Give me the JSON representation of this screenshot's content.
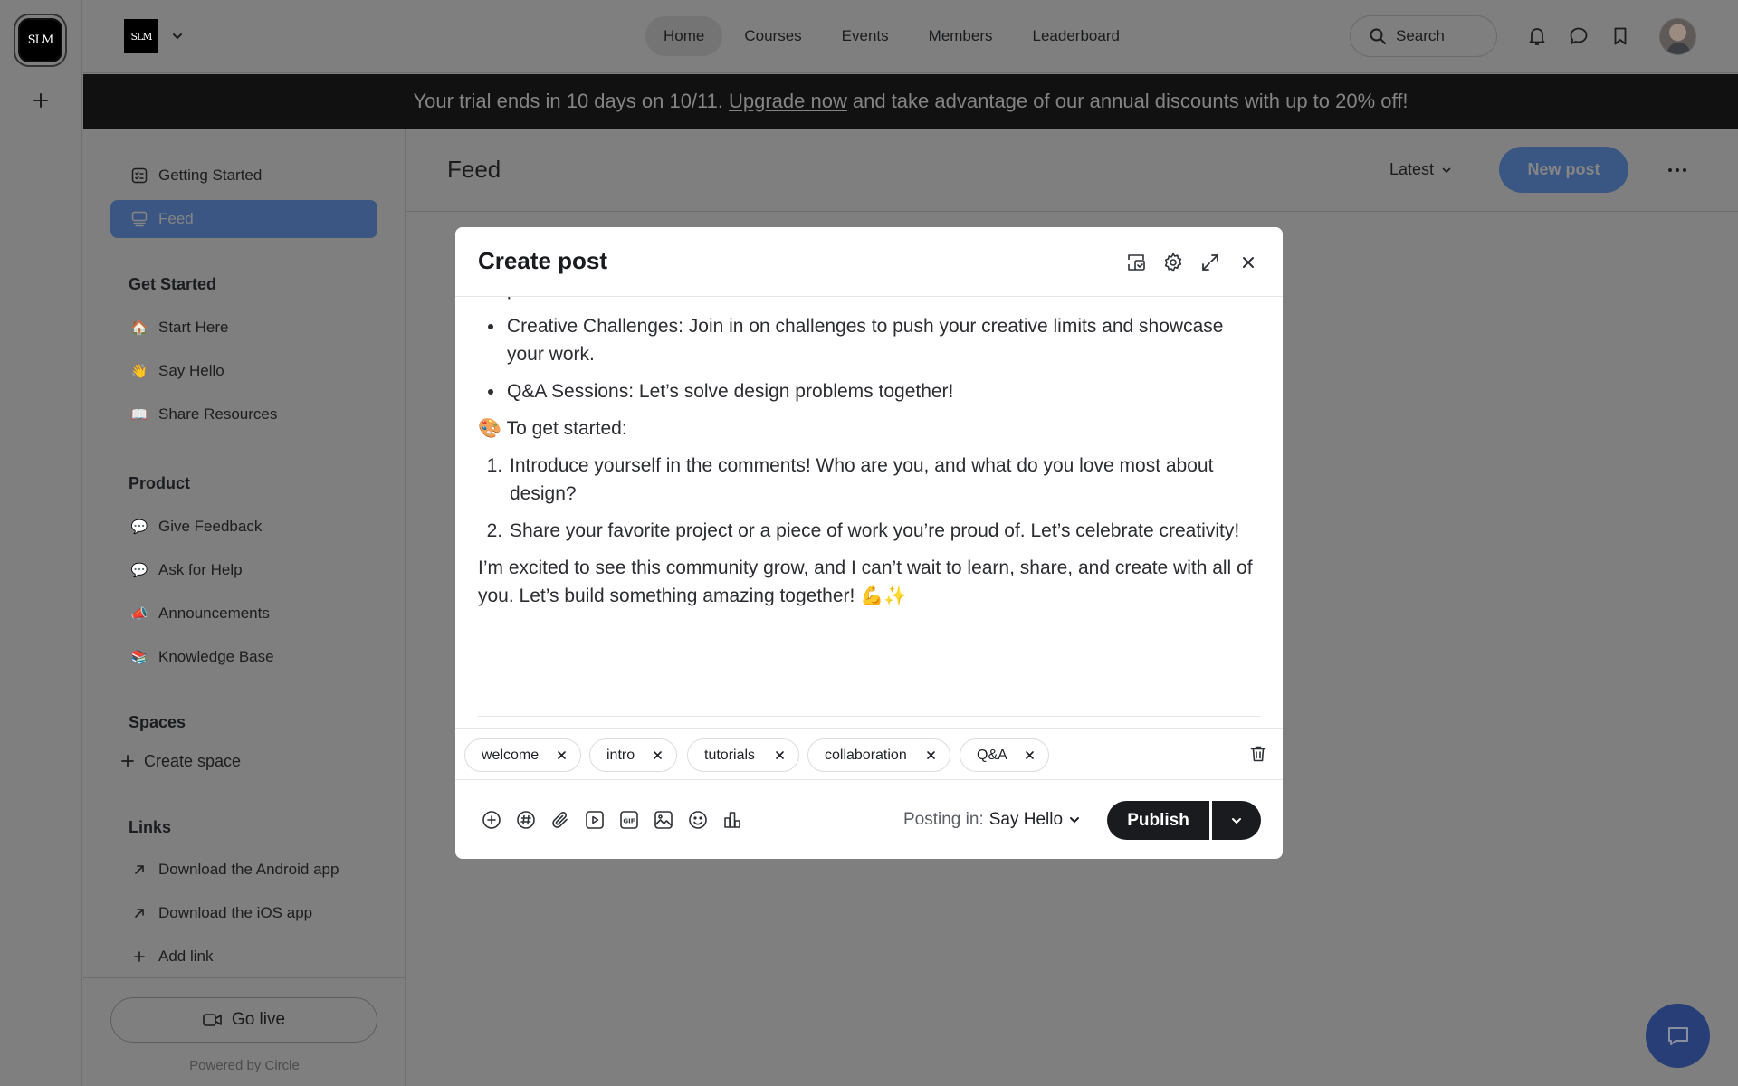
{
  "rail": {
    "logo_text": "SLM",
    "add_icon": "plus-icon"
  },
  "header": {
    "brand_text": "SLM",
    "nav": [
      {
        "label": "Home",
        "active": true
      },
      {
        "label": "Courses"
      },
      {
        "label": "Events"
      },
      {
        "label": "Members"
      },
      {
        "label": "Leaderboard"
      }
    ],
    "search_label": "Search",
    "icons": [
      "bell-icon",
      "chat-icon",
      "bookmark-icon"
    ]
  },
  "banner": {
    "before": "Your trial ends in 10 days on 10/11.",
    "link": "Upgrade now",
    "after": "and take advantage of our annual discounts with up to 20% off!"
  },
  "sidebar": {
    "top_items": [
      {
        "label": "Getting Started",
        "icon": "checklist-icon"
      },
      {
        "label": "Feed",
        "icon": "feed-icon",
        "active": true
      }
    ],
    "sections": [
      {
        "heading": "Get Started",
        "items": [
          {
            "label": "Start Here",
            "emoji": "🏠"
          },
          {
            "label": "Say Hello",
            "emoji": "👋"
          },
          {
            "label": "Share Resources",
            "emoji": "📖"
          }
        ]
      },
      {
        "heading": "Product",
        "items": [
          {
            "label": "Give Feedback",
            "emoji": "💬"
          },
          {
            "label": "Ask for Help",
            "emoji": "💬"
          },
          {
            "label": "Announcements",
            "emoji": "📣"
          },
          {
            "label": "Knowledge Base",
            "emoji": "📚"
          }
        ]
      },
      {
        "heading": "Spaces",
        "items": [
          {
            "label": "Create space",
            "icon": "plus-icon"
          }
        ]
      },
      {
        "heading": "Links",
        "items": [
          {
            "label": "Download the Android app",
            "icon": "arrow-up-right-icon"
          },
          {
            "label": "Download the iOS app",
            "icon": "arrow-up-right-icon"
          },
          {
            "label": "Add link",
            "icon": "plus-icon"
          }
        ]
      }
    ],
    "go_live": "Go live",
    "powered_by": "Powered by Circle"
  },
  "feed": {
    "title": "Feed",
    "sort": "Latest",
    "new_post": "New post"
  },
  "modal": {
    "title": "Create post",
    "body": {
      "bullets": [
        "Creative Challenges: Join in on challenges to push your creative limits and showcase your work.",
        "Q&A Sessions: Let’s solve design problems together!"
      ],
      "get_started_emoji": "🎨",
      "get_started": "To get started:",
      "steps": [
        "Introduce yourself in the comments! Who are you, and what do you love most about design?",
        "Share your favorite project or a piece of work you’re proud of. Let’s celebrate creativity!"
      ],
      "closing": "I’m excited to see this community grow, and I can’t wait to learn, share, and create with all of you. Let’s build something amazing together! 💪✨"
    },
    "tags": [
      "welcome",
      "intro",
      "tutorials",
      "collaboration",
      "Q&A"
    ],
    "toolbar_icons": [
      "add-icon",
      "hashtag-icon",
      "attachment-icon",
      "video-icon",
      "gif-icon",
      "image-icon",
      "emoji-icon",
      "poll-icon"
    ],
    "posting_in_label": "Posting in:",
    "posting_in_space": "Say Hello",
    "publish": "Publish"
  },
  "colors": {
    "overlay": "#7f7f7f",
    "banner": "#111111",
    "accent": "#3b5683",
    "primary_button": "#191b1f",
    "chat_button": "#273e77"
  }
}
